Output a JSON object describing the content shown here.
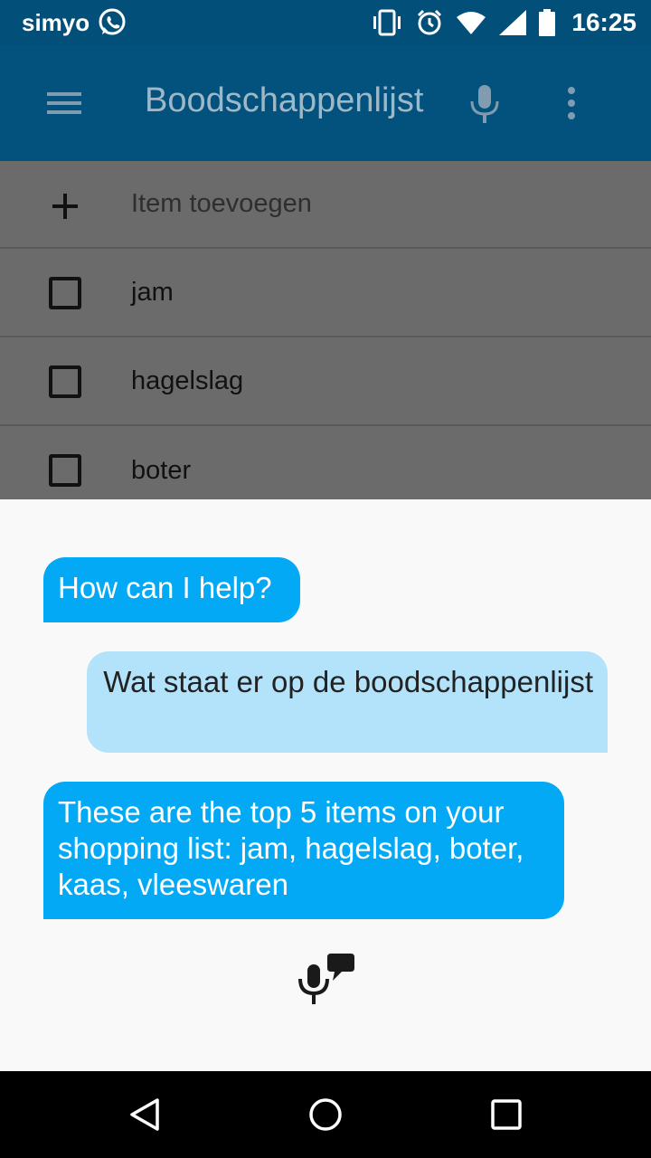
{
  "status_bar": {
    "carrier": "simyo",
    "time": "16:25",
    "icons": [
      "whatsapp-icon",
      "vibrate-icon",
      "alarm-icon",
      "wifi-icon",
      "signal-icon",
      "battery-icon"
    ]
  },
  "app_bar": {
    "title": "Boodschappenlijst",
    "icons": [
      "menu-icon",
      "mic-icon",
      "more-vert-icon"
    ]
  },
  "list": {
    "add_item_label": "Item toevoegen",
    "items": [
      {
        "label": "jam",
        "checked": false
      },
      {
        "label": "hagelslag",
        "checked": false
      },
      {
        "label": "boter",
        "checked": false
      }
    ]
  },
  "assistant": {
    "messages": [
      {
        "from": "assistant",
        "text": "How can I help?"
      },
      {
        "from": "user",
        "text": "Wat staat er op de boodschappenlijst"
      },
      {
        "from": "assistant",
        "text": "These are the top 5 items on your shopping list: jam, hagelslag, boter, kaas, vleeswaren"
      }
    ],
    "icon": "voice-assistant-icon"
  },
  "nav_bar": {
    "icons": [
      "back-icon",
      "home-icon",
      "recents-icon"
    ]
  },
  "colors": {
    "status_bar": "#02507a",
    "app_bar": "#02527d",
    "assistant_bubble": "#03a9f4",
    "user_bubble": "#b3e3fb",
    "sheet": "#f9f9f9"
  }
}
